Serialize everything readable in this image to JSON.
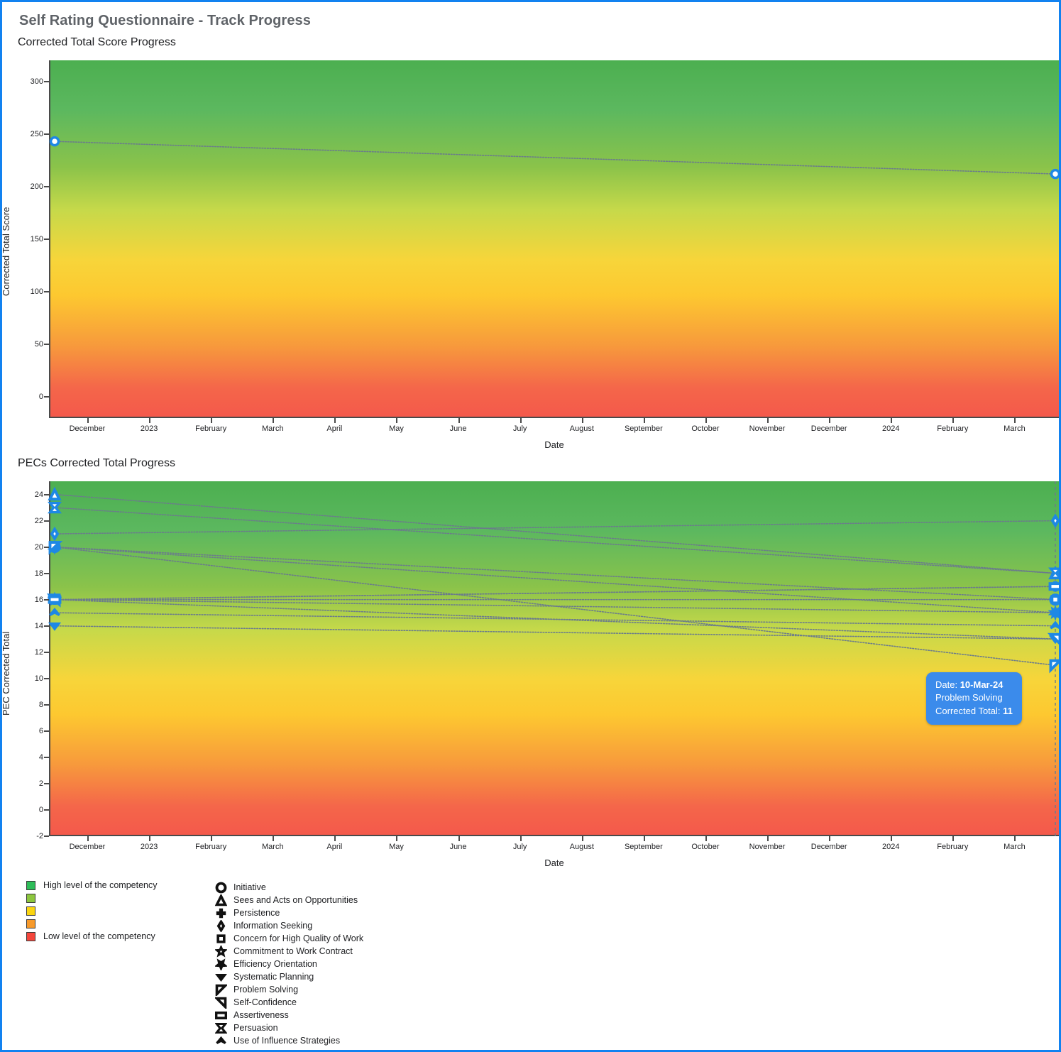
{
  "header": {
    "title": "Self Rating Questionnaire - Track Progress"
  },
  "charts": [
    {
      "id": "corrected-total",
      "title": "Corrected Total Score Progress",
      "xlabel": "Date",
      "ylabel": "Corrected Total Score"
    },
    {
      "id": "pecs-corrected-total",
      "title": "PECs Corrected Total Progress",
      "xlabel": "Date",
      "ylabel": "PEC Corrected Total"
    }
  ],
  "tooltip": {
    "date_label": "Date:",
    "date_value": "10-Mar-24",
    "series_name": "Problem Solving",
    "value_label": "Corrected Total:",
    "value": "11"
  },
  "color_legend": {
    "items": [
      {
        "color": "#2ebd59",
        "label": "High level of the competency"
      },
      {
        "color": "#8cc63e",
        "label": ""
      },
      {
        "color": "#fbd511",
        "label": ""
      },
      {
        "color": "#f79a2b",
        "label": ""
      },
      {
        "color": "#f4463c",
        "label": "Low level of the competency"
      }
    ]
  },
  "marker_legend": {
    "items": [
      {
        "icon": "circle-marker-icon",
        "label": "Initiative"
      },
      {
        "icon": "triangle-up-marker-icon",
        "label": "Sees and Acts on Opportunities"
      },
      {
        "icon": "plus-marker-icon",
        "label": "Persistence"
      },
      {
        "icon": "diamond-marker-icon",
        "label": "Information Seeking"
      },
      {
        "icon": "small-square-marker-icon",
        "label": "Concern for High Quality of Work"
      },
      {
        "icon": "star-marker-icon",
        "label": "Commitment to Work Contract"
      },
      {
        "icon": "star-bottom-marker-icon",
        "label": "Efficiency Orientation"
      },
      {
        "icon": "triangle-down-marker-icon",
        "label": "Systematic Planning"
      },
      {
        "icon": "left-triangle-marker-icon",
        "label": "Problem Solving"
      },
      {
        "icon": "right-triangle-marker-icon",
        "label": "Self-Confidence"
      },
      {
        "icon": "wide-square-marker-icon",
        "label": "Assertiveness"
      },
      {
        "icon": "bowtie-marker-icon",
        "label": "Persuasion"
      },
      {
        "icon": "caret-up-marker-icon",
        "label": "Use of Influence Strategies"
      }
    ]
  },
  "chart_data": [
    {
      "type": "line",
      "id": "corrected-total",
      "title": "Corrected Total Score Progress",
      "xlabel": "Date",
      "ylabel": "Corrected Total Score",
      "grid": false,
      "legend_position": "none",
      "ylim": [
        -20,
        320
      ],
      "yticks": [
        0,
        50,
        100,
        150,
        200,
        250,
        300
      ],
      "xticks": [
        "December",
        "2023",
        "February",
        "March",
        "April",
        "May",
        "June",
        "July",
        "August",
        "September",
        "October",
        "November",
        "December",
        "2024",
        "February",
        "March"
      ],
      "series": [
        {
          "name": "Corrected Total Score",
          "marker": "circle-marker-icon",
          "color": "#1e88e5",
          "x": [
            "25-Nov-22",
            "10-Mar-24"
          ],
          "values": [
            243,
            212
          ]
        }
      ]
    },
    {
      "type": "line",
      "id": "pecs-corrected-total",
      "title": "PECs Corrected Total Progress",
      "xlabel": "Date",
      "ylabel": "PEC Corrected Total",
      "grid": false,
      "legend_position": "bottom",
      "ylim": [
        -2,
        25
      ],
      "yticks": [
        -2,
        0,
        2,
        4,
        6,
        8,
        10,
        12,
        14,
        16,
        18,
        20,
        22,
        24
      ],
      "xticks": [
        "December",
        "2023",
        "February",
        "March",
        "April",
        "May",
        "June",
        "July",
        "August",
        "September",
        "October",
        "November",
        "December",
        "2024",
        "February",
        "March"
      ],
      "x": [
        "25-Nov-22",
        "10-Mar-24"
      ],
      "series": [
        {
          "name": "Initiative",
          "marker": "circle-marker-icon",
          "color": "#1e88e5",
          "values": [
            20,
            16
          ]
        },
        {
          "name": "Sees and Acts on Opportunities",
          "marker": "triangle-up-marker-icon",
          "color": "#1e88e5",
          "values": [
            24,
            18
          ]
        },
        {
          "name": "Persistence",
          "marker": "plus-marker-icon",
          "color": "#1e88e5",
          "values": [
            16,
            17
          ]
        },
        {
          "name": "Information Seeking",
          "marker": "diamond-marker-icon",
          "color": "#1e88e5",
          "values": [
            21,
            22
          ]
        },
        {
          "name": "Concern for High Quality of Work",
          "marker": "small-square-marker-icon",
          "color": "#1e88e5",
          "values": [
            16,
            16
          ]
        },
        {
          "name": "Commitment to Work Contract",
          "marker": "star-marker-icon",
          "color": "#1e88e5",
          "values": [
            16,
            15
          ]
        },
        {
          "name": "Efficiency Orientation",
          "marker": "star-bottom-marker-icon",
          "color": "#1e88e5",
          "values": [
            20,
            15
          ]
        },
        {
          "name": "Systematic Planning",
          "marker": "triangle-down-marker-icon",
          "color": "#1e88e5",
          "values": [
            14,
            13
          ]
        },
        {
          "name": "Problem Solving",
          "marker": "left-triangle-marker-icon",
          "color": "#1e88e5",
          "values": [
            20,
            11
          ]
        },
        {
          "name": "Self-Confidence",
          "marker": "right-triangle-marker-icon",
          "color": "#1e88e5",
          "values": [
            16,
            13
          ]
        },
        {
          "name": "Assertiveness",
          "marker": "wide-square-marker-icon",
          "color": "#1e88e5",
          "values": [
            16,
            17
          ]
        },
        {
          "name": "Persuasion",
          "marker": "bowtie-marker-icon",
          "color": "#1e88e5",
          "values": [
            23,
            18
          ]
        },
        {
          "name": "Use of Influence Strategies",
          "marker": "caret-up-marker-icon",
          "color": "#1e88e5",
          "values": [
            15,
            14
          ]
        }
      ]
    }
  ]
}
